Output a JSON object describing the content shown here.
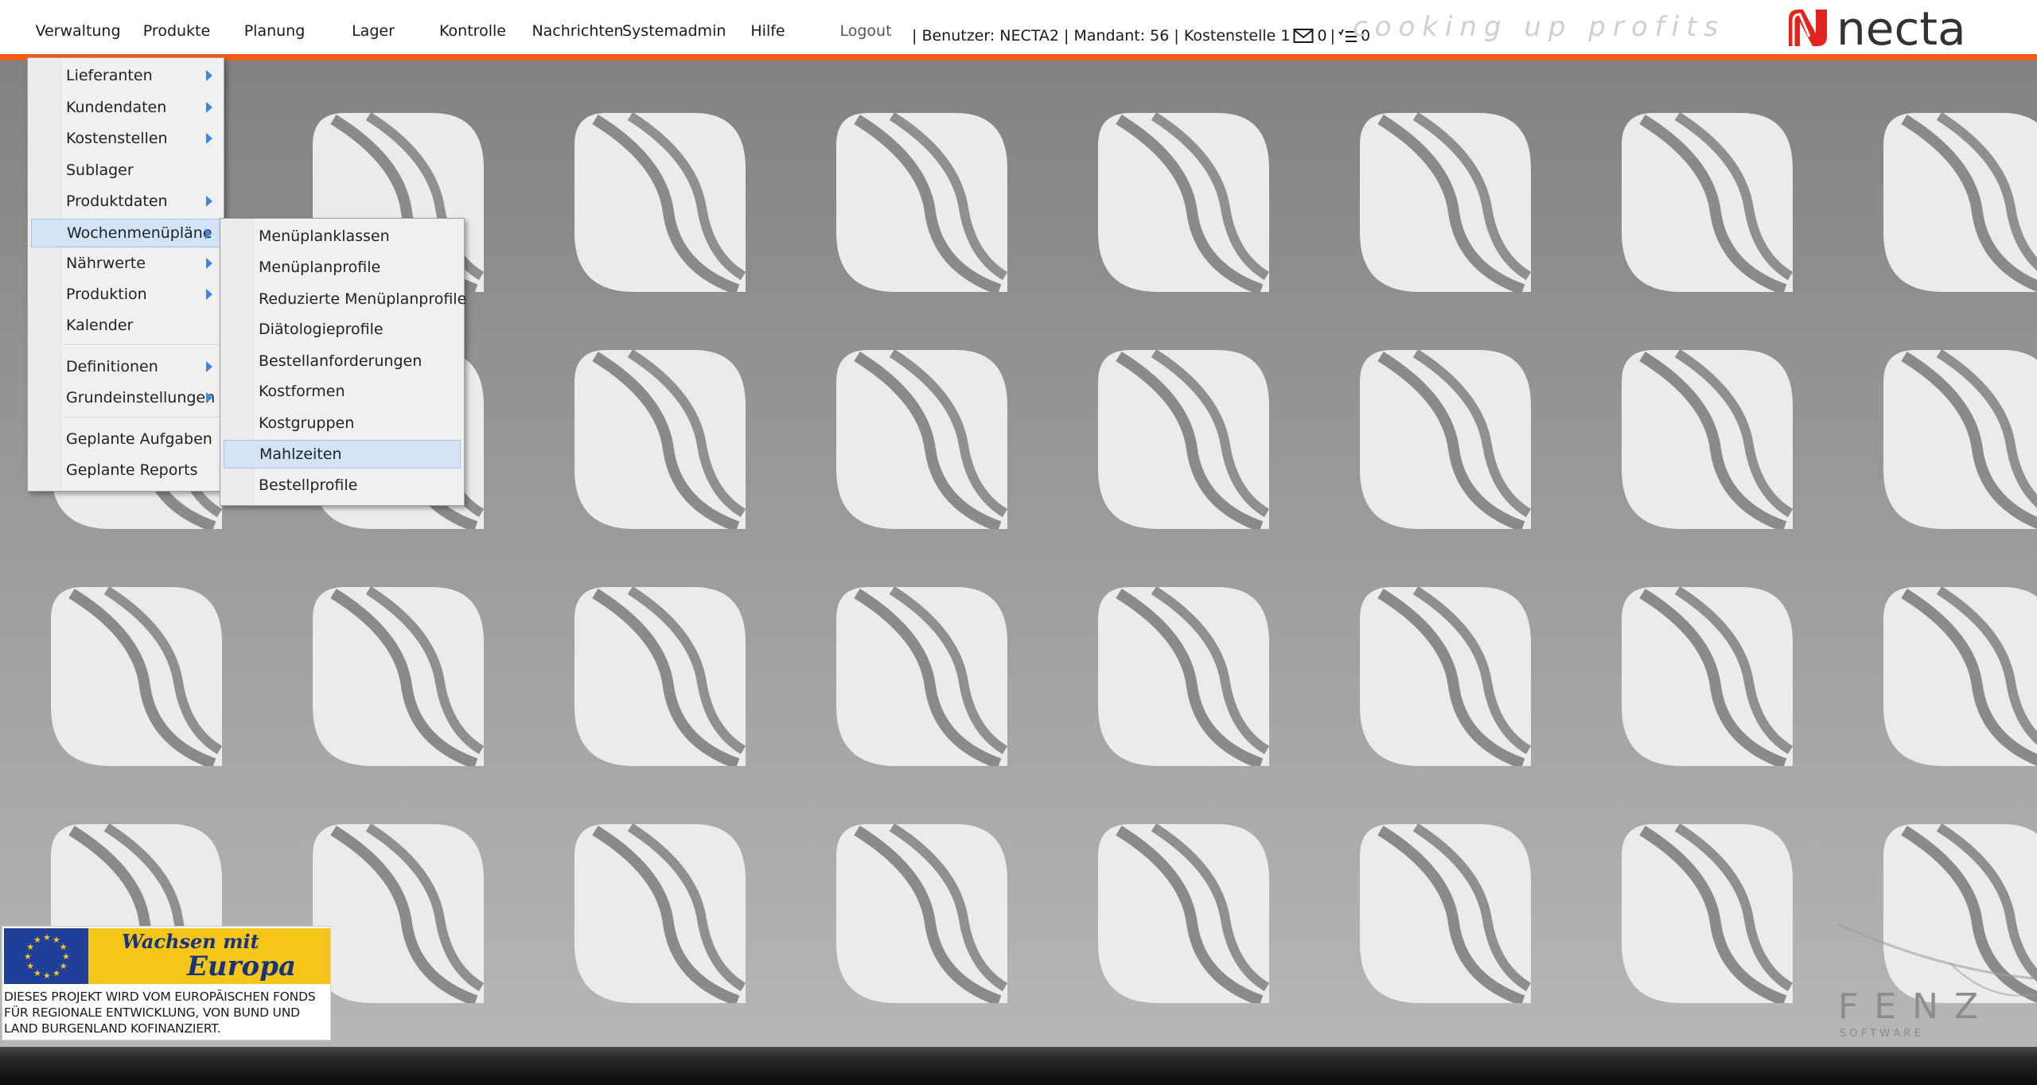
{
  "menubar": {
    "items": [
      "Verwaltung",
      "Produkte",
      "Planung",
      "Lager",
      "Kontrolle",
      "Nachrichten",
      "Systemadmin",
      "Hilfe"
    ],
    "logout": "Logout"
  },
  "userinfo": {
    "text": "| Benutzer: NECTA2 | Mandant: 56 | Kostenstelle 1",
    "messages_count": "0",
    "separator": "|",
    "tasks_count": "0"
  },
  "brand": {
    "tagline": "cooking up profits",
    "logo_text": "necta",
    "fenz_text": "FENZ",
    "fenz_sub": "S O F T W A R E",
    "accent_color": "#f25c19",
    "logo_red": "#e3231d"
  },
  "verwaltung_menu": {
    "items": [
      {
        "label": "Lieferanten",
        "submenu": true
      },
      {
        "label": "Kundendaten",
        "submenu": true
      },
      {
        "label": "Kostenstellen",
        "submenu": true
      },
      {
        "label": "Sublager",
        "submenu": false
      },
      {
        "label": "Produktdaten",
        "submenu": true
      },
      {
        "label": "Wochenmenüpläne",
        "submenu": true,
        "highlighted": true
      },
      {
        "label": "Nährwerte",
        "submenu": true
      },
      {
        "label": "Produktion",
        "submenu": true
      },
      {
        "label": "Kalender",
        "submenu": false
      },
      {
        "label": "Definitionen",
        "submenu": true
      },
      {
        "label": "Grundeinstellungen",
        "submenu": true
      },
      {
        "label": "Geplante Aufgaben",
        "submenu": false
      },
      {
        "label": "Geplante Reports",
        "submenu": false
      }
    ]
  },
  "wochenmenue_submenu": {
    "items": [
      {
        "label": "Menüplanklassen"
      },
      {
        "label": "Menüplanprofile"
      },
      {
        "label": "Reduzierte Menüplanprofile"
      },
      {
        "label": "Diätologieprofile"
      },
      {
        "label": "Bestellanforderungen"
      },
      {
        "label": "Kostformen"
      },
      {
        "label": "Kostgruppen"
      },
      {
        "label": "Mahlzeiten",
        "highlighted": true
      },
      {
        "label": "Bestellprofile"
      }
    ]
  },
  "eu_banner": {
    "line1": "Wachsen mit",
    "line2": "Europa",
    "description": "DIESES PROJEKT WIRD VOM EUROPÄISCHEN FONDS FÜR REGIONALE ENTWICKLUNG, VON BUND UND LAND BURGENLAND KOFINANZIERT."
  },
  "icons": [
    "envelope-icon",
    "task-list-icon",
    "submenu-arrow-icon",
    "eu-flag-icon",
    "leaf-pattern-icon"
  ]
}
